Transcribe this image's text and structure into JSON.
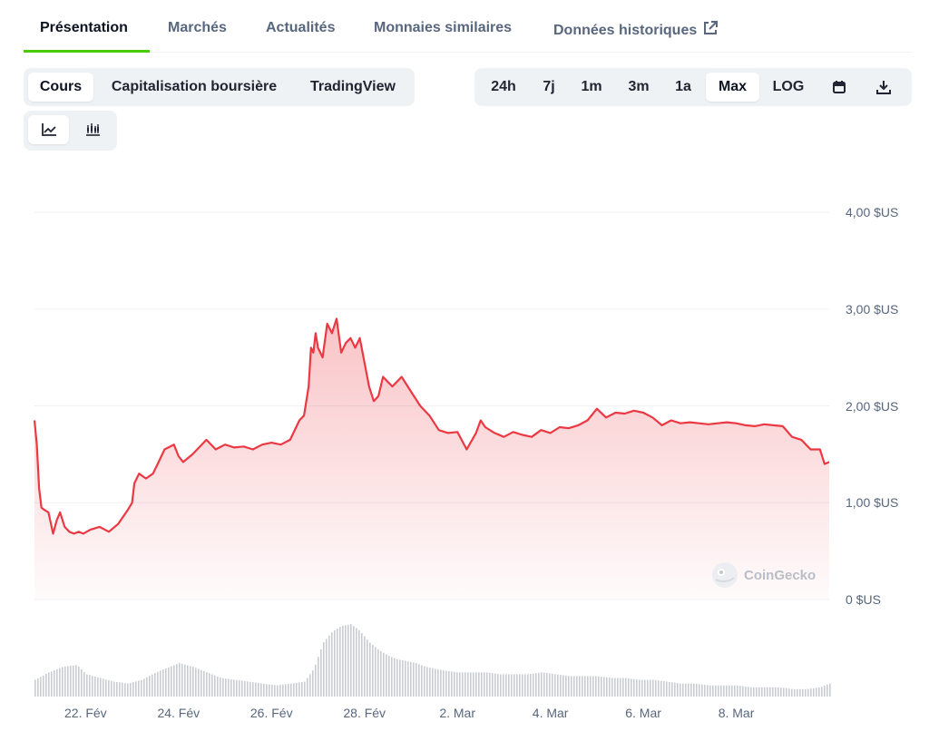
{
  "tabs": [
    {
      "label": "Présentation",
      "active": true
    },
    {
      "label": "Marchés",
      "active": false
    },
    {
      "label": "Actualités",
      "active": false
    },
    {
      "label": "Monnaies similaires",
      "active": false
    },
    {
      "label": "Données historiques",
      "active": false
    }
  ],
  "metric_toggle": [
    "Cours",
    "Capitalisation boursière",
    "TradingView"
  ],
  "metric_selected": "Cours",
  "range_toggle": [
    "24h",
    "7j",
    "1m",
    "3m",
    "1a",
    "Max",
    "LOG"
  ],
  "range_selected": "Max",
  "icons": {
    "external": "external-link-icon",
    "calendar": "calendar-icon",
    "download": "download-icon",
    "line_chart": "line-chart-icon",
    "candle_chart": "candlestick-chart-icon",
    "watermark": "coingecko-logo-icon"
  },
  "watermark": "CoinGecko",
  "colors": {
    "accent_green": "#4bcc00",
    "line": "#ea3943",
    "fill": "#ea3943",
    "volume": "#c9ccd3",
    "grid": "#eff2f5"
  },
  "chart_data": {
    "type": "line",
    "title": "",
    "xlabel": "",
    "ylabel": "",
    "y_axis_side": "right",
    "ylim": [
      0,
      4
    ],
    "y_ticks": [
      "0 $US",
      "1,00 $US",
      "2,00 $US",
      "3,00 $US",
      "4,00 $US"
    ],
    "x_ticks": [
      "22. Fév",
      "24. Fév",
      "26. Fév",
      "28. Fév",
      "2. Mar",
      "4. Mar",
      "6. Mar",
      "8. Mar"
    ],
    "x_tick_days": [
      1,
      3,
      5,
      7,
      9,
      11,
      13,
      15
    ],
    "xlim_days": [
      -0.1,
      17.0
    ],
    "grid": true,
    "series": [
      {
        "name": "",
        "x_days": [
          -0.1,
          -0.05,
          0.0,
          0.05,
          0.1,
          0.2,
          0.3,
          0.38,
          0.45,
          0.55,
          0.65,
          0.75,
          0.85,
          0.95,
          1.1,
          1.3,
          1.5,
          1.7,
          1.9,
          2.0,
          2.05,
          2.15,
          2.3,
          2.45,
          2.55,
          2.7,
          2.9,
          3.0,
          3.1,
          3.3,
          3.5,
          3.6,
          3.8,
          4.0,
          4.2,
          4.4,
          4.6,
          4.8,
          5.0,
          5.2,
          5.4,
          5.6,
          5.7,
          5.8,
          5.85,
          5.9,
          5.95,
          6.0,
          6.1,
          6.2,
          6.3,
          6.4,
          6.5,
          6.6,
          6.7,
          6.8,
          6.9,
          7.0,
          7.1,
          7.2,
          7.3,
          7.4,
          7.5,
          7.6,
          7.8,
          8.0,
          8.2,
          8.4,
          8.6,
          8.8,
          9.0,
          9.2,
          9.4,
          9.5,
          9.6,
          9.8,
          10.0,
          10.2,
          10.4,
          10.6,
          10.8,
          11.0,
          11.2,
          11.4,
          11.6,
          11.8,
          12.0,
          12.2,
          12.4,
          12.6,
          12.8,
          13.0,
          13.2,
          13.4,
          13.6,
          13.8,
          14.0,
          14.2,
          14.4,
          14.6,
          14.8,
          15.0,
          15.2,
          15.4,
          15.6,
          15.8,
          16.0,
          16.2,
          16.4,
          16.6,
          16.8,
          16.9,
          17.0
        ],
        "values": [
          1.85,
          1.6,
          1.15,
          0.95,
          0.93,
          0.9,
          0.68,
          0.82,
          0.9,
          0.75,
          0.7,
          0.68,
          0.7,
          0.68,
          0.72,
          0.75,
          0.7,
          0.78,
          0.92,
          1.0,
          1.2,
          1.3,
          1.25,
          1.3,
          1.4,
          1.55,
          1.6,
          1.48,
          1.42,
          1.5,
          1.6,
          1.65,
          1.55,
          1.6,
          1.57,
          1.58,
          1.55,
          1.6,
          1.62,
          1.6,
          1.65,
          1.85,
          1.9,
          2.2,
          2.6,
          2.55,
          2.75,
          2.6,
          2.5,
          2.85,
          2.75,
          2.9,
          2.55,
          2.65,
          2.7,
          2.6,
          2.7,
          2.45,
          2.2,
          2.05,
          2.1,
          2.3,
          2.25,
          2.2,
          2.3,
          2.15,
          2.0,
          1.9,
          1.75,
          1.72,
          1.73,
          1.55,
          1.72,
          1.85,
          1.78,
          1.72,
          1.68,
          1.73,
          1.7,
          1.68,
          1.75,
          1.72,
          1.78,
          1.77,
          1.8,
          1.85,
          1.97,
          1.88,
          1.93,
          1.92,
          1.95,
          1.93,
          1.88,
          1.8,
          1.85,
          1.82,
          1.83,
          1.82,
          1.81,
          1.82,
          1.83,
          1.82,
          1.8,
          1.79,
          1.81,
          1.8,
          1.79,
          1.68,
          1.65,
          1.55,
          1.55,
          1.4,
          1.42
        ]
      }
    ],
    "volume": {
      "x_days": [
        -0.1,
        0.2,
        0.5,
        0.8,
        1.0,
        1.3,
        1.6,
        1.9,
        2.2,
        2.5,
        2.8,
        3.0,
        3.3,
        3.6,
        3.9,
        4.2,
        4.5,
        4.8,
        5.1,
        5.4,
        5.7,
        5.9,
        6.1,
        6.3,
        6.5,
        6.7,
        6.9,
        7.1,
        7.3,
        7.5,
        7.7,
        7.9,
        8.1,
        8.3,
        8.5,
        8.7,
        9.0,
        9.3,
        9.6,
        9.9,
        10.2,
        10.5,
        10.8,
        11.1,
        11.4,
        11.7,
        12.0,
        12.3,
        12.6,
        12.9,
        13.2,
        13.5,
        13.8,
        14.1,
        14.4,
        14.7,
        15.0,
        15.3,
        15.6,
        15.9,
        16.2,
        16.5,
        16.8,
        17.0
      ],
      "values": [
        18,
        26,
        32,
        34,
        24,
        20,
        16,
        14,
        18,
        26,
        32,
        36,
        32,
        26,
        20,
        18,
        16,
        14,
        12,
        14,
        16,
        30,
        58,
        70,
        76,
        78,
        70,
        58,
        50,
        44,
        40,
        38,
        36,
        32,
        30,
        28,
        26,
        26,
        26,
        24,
        24,
        24,
        26,
        24,
        22,
        22,
        22,
        20,
        20,
        18,
        18,
        16,
        14,
        14,
        12,
        12,
        12,
        10,
        10,
        10,
        8,
        8,
        10,
        14
      ]
    }
  }
}
